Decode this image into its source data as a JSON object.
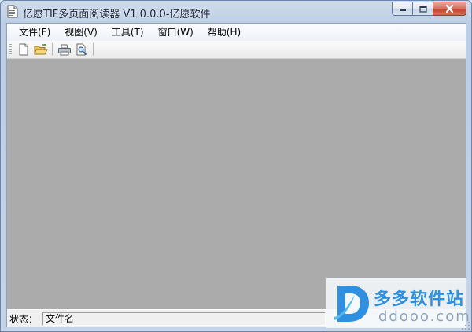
{
  "window": {
    "title": "亿愿TIF多页面阅读器 V1.0.0.0-亿愿软件",
    "icon": "document-icon",
    "controls": [
      "minimize-icon",
      "maximize-icon",
      "close-icon"
    ]
  },
  "menubar": {
    "items": [
      {
        "label": "文件(F)"
      },
      {
        "label": "视图(V)"
      },
      {
        "label": "工具(T)"
      },
      {
        "label": "窗口(W)"
      },
      {
        "label": "帮助(H)"
      }
    ]
  },
  "toolbar": {
    "buttons": [
      "new-file-icon",
      "open-folder-icon",
      "print-icon",
      "print-preview-icon"
    ]
  },
  "statusbar": {
    "label": "状态：",
    "filename": "文件名"
  },
  "watermark": {
    "site_name_cn": "多多软件站",
    "domain": "ddooo.com"
  },
  "colors": {
    "workspace": "#ababab",
    "watermark_blue": "#2f8fe0",
    "close_button": "#c2412c"
  }
}
